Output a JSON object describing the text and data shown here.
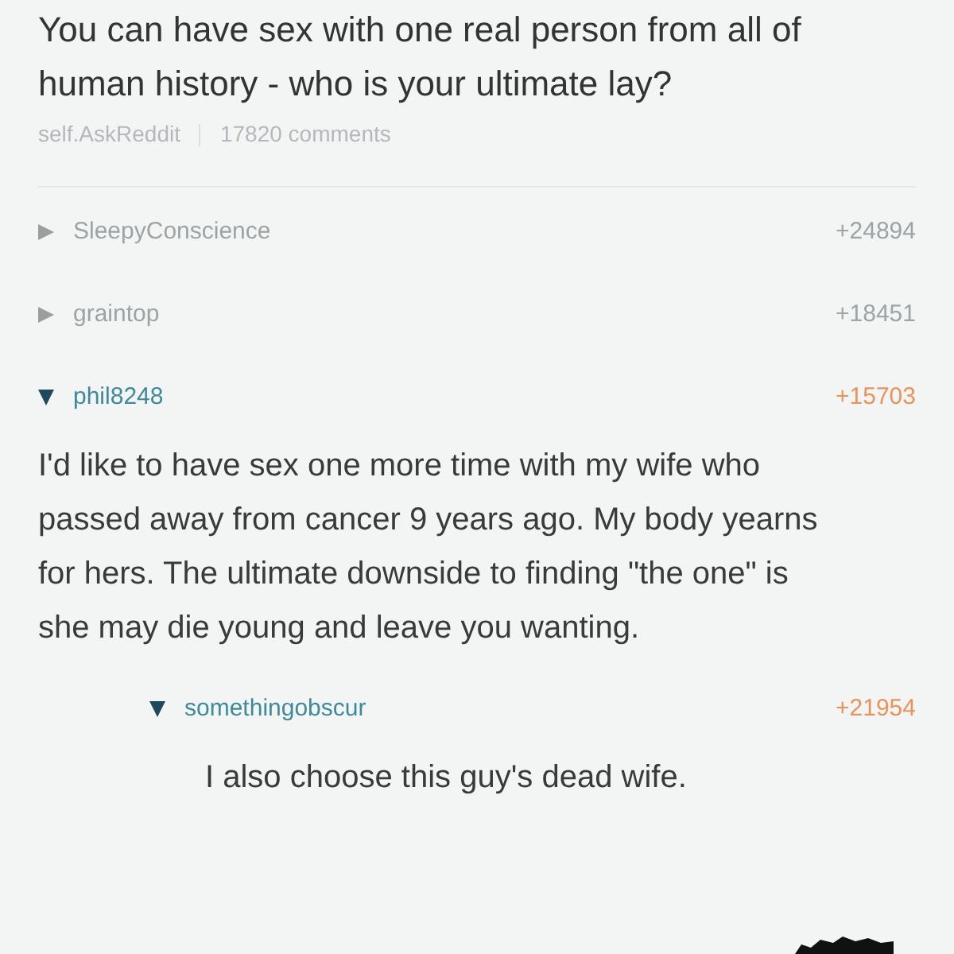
{
  "post": {
    "title": "You can have sex with one real person from all of human history - who is your ultimate lay?",
    "subreddit": "self.AskReddit",
    "comments_count": "17820 comments"
  },
  "comments": [
    {
      "author": "SleepyConscience",
      "score": "+24894",
      "expanded": false
    },
    {
      "author": "graintop",
      "score": "+18451",
      "expanded": false
    },
    {
      "author": "phil8248",
      "score": "+15703",
      "expanded": true,
      "body": "I'd like to have sex one more time with my wife who passed away from cancer 9 years ago. My body yearns for hers.  The ultimate downside to finding \"the one\" is she may die young and leave you wanting.",
      "children": [
        {
          "author": "somethingobscur",
          "score": "+21954",
          "expanded": true,
          "body": "I also choose this guy's dead wife."
        }
      ]
    }
  ]
}
